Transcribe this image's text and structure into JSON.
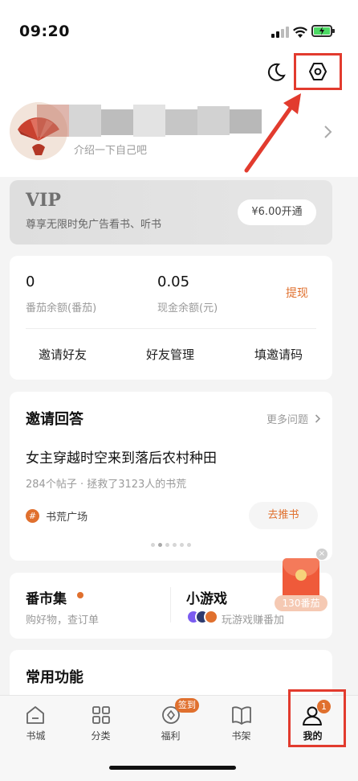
{
  "status_bar": {
    "time": "09:20"
  },
  "profile": {
    "intro": "介绍一下自己吧"
  },
  "vip": {
    "badge": "VIP",
    "desc": "尊享无限时免广告看书、听书",
    "button": "¥6.00开通"
  },
  "wallet": {
    "tomato_value": "0",
    "tomato_label": "番茄余额(番茄)",
    "cash_value": "0.05",
    "cash_label": "现金余额(元)",
    "withdraw": "提现"
  },
  "friends": {
    "invite": "邀请好友",
    "manage": "好友管理",
    "code": "填邀请码"
  },
  "qa": {
    "title": "邀请回答",
    "more": "更多问题",
    "question": "女主穿越时空来到落后农村种田",
    "stats": "284个帖子 · 拯救了3123人的书荒",
    "tag": "书荒广场",
    "recommend": "去推书"
  },
  "market": {
    "title": "番市集",
    "desc": "购好物，查订单"
  },
  "games": {
    "title": "小游戏",
    "desc": "玩游戏赚番加"
  },
  "red_packet": {
    "reward": "130番茄"
  },
  "common": {
    "title": "常用功能"
  },
  "tabbar": {
    "items": [
      {
        "label": "书城"
      },
      {
        "label": "分类"
      },
      {
        "label": "福利",
        "badge": "签到"
      },
      {
        "label": "书架"
      },
      {
        "label": "我的",
        "badge": "1"
      }
    ]
  },
  "colors": {
    "accent": "#e0702e",
    "annotation": "#e23b2e"
  }
}
